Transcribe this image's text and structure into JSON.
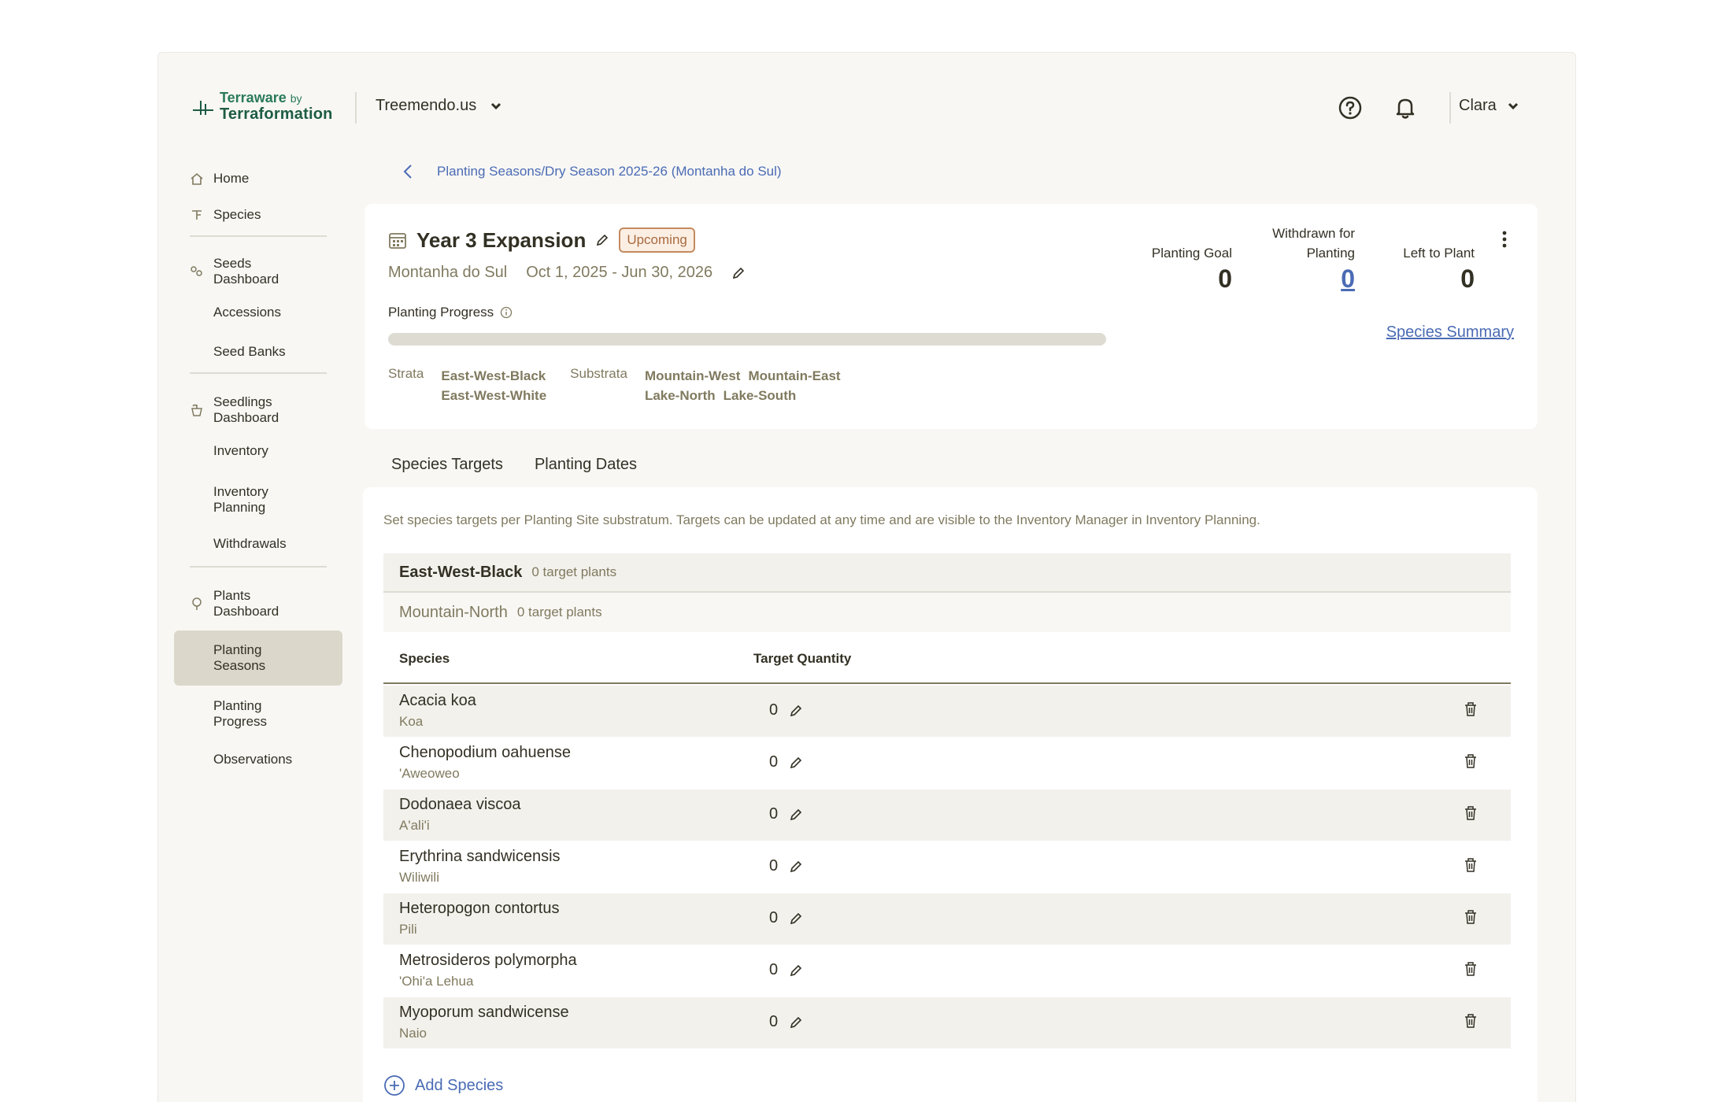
{
  "colors": {
    "accent": "#4a6bb4",
    "brand_green": "#2a7a5a",
    "upcoming_badge": "#c58a5e",
    "active_nav": "#dbd8cb"
  },
  "header": {
    "logo_line1": "Terraware",
    "logo_by": "by",
    "logo_line2": "Terraformation",
    "org": "Treemendo.us",
    "user": "Clara",
    "icons": [
      "help-circle-icon",
      "bell-icon",
      "chevron-down-icon"
    ]
  },
  "sidebar": {
    "home": "Home",
    "species": "Species",
    "seeds_dashboard": "Seeds Dashboard",
    "accessions": "Accessions",
    "seed_banks": "Seed Banks",
    "seedlings_dashboard": "Seedlings Dashboard",
    "inventory": "Inventory",
    "inventory_planning": "Inventory Planning",
    "withdrawals": "Withdrawals",
    "plants_dashboard": "Plants Dashboard",
    "planting_seasons": "Planting Seasons",
    "planting_progress": "Planting Progress",
    "observations": "Observations",
    "active_item": "Planting Seasons"
  },
  "breadcrumb": "Planting Seasons/Dry Season 2025-26 (Montanha do Sul)",
  "season": {
    "title": "Year 3 Expansion",
    "status": "Upcoming",
    "site": "Montanha do Sul",
    "dates": "Oct 1, 2025 - Jun 30, 2026",
    "progress_label": "Planting Progress",
    "progress_fraction": 0,
    "strata_label": "Strata",
    "strata_values": [
      "East-West-Black",
      "East-West-White"
    ],
    "substrata_label": "Substrata",
    "substrata_line1": [
      "Mountain-West",
      "Mountain-East"
    ],
    "substrata_line2": [
      "Lake-North",
      "Lake-South"
    ],
    "stats": {
      "goal_label": "Planting Goal",
      "goal_value": "0",
      "withdrawn_label_1": "Withdrawn for",
      "withdrawn_label_2": "Planting",
      "withdrawn_value": "0",
      "left_label": "Left to Plant",
      "left_value": "0"
    },
    "species_summary_link": "Species Summary"
  },
  "tabs": [
    "Species Targets",
    "Planting Dates"
  ],
  "active_tab": "Species Targets",
  "targets": {
    "description": "Set species targets per Planting Site substratum. Targets can be updated at any time and are visible to the Inventory Manager in Inventory Planning.",
    "stratum_name": "East-West-Black",
    "stratum_count": "0 target plants",
    "substratum_name": "Mountain-North",
    "substratum_count": "0 target plants",
    "col_species": "Species",
    "col_target": "Target Quantity",
    "rows": [
      {
        "sci": "Acacia koa",
        "common": "Koa",
        "qty": "0"
      },
      {
        "sci": "Chenopodium oahuense",
        "common": "'Aweoweo",
        "qty": "0"
      },
      {
        "sci": "Dodonaea viscoa",
        "common": "A'ali'i",
        "qty": "0"
      },
      {
        "sci": "Erythrina sandwicensis",
        "common": "Wiliwili",
        "qty": "0"
      },
      {
        "sci": "Heteropogon contortus",
        "common": "Pili",
        "qty": "0"
      },
      {
        "sci": "Metrosideros polymorpha",
        "common": "'Ohi'a Lehua",
        "qty": "0"
      },
      {
        "sci": "Myoporum sandwicense",
        "common": "Naio",
        "qty": "0"
      }
    ],
    "add_species": "Add Species"
  }
}
